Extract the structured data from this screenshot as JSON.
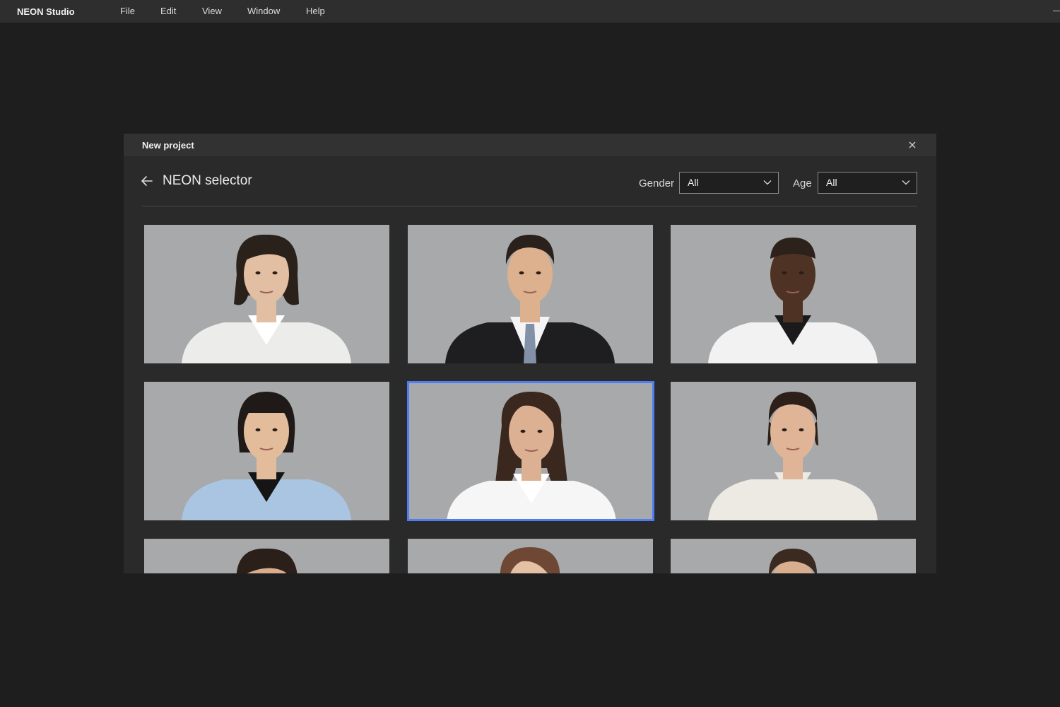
{
  "app": {
    "name": "NEON Studio",
    "menu": [
      "File",
      "Edit",
      "View",
      "Window",
      "Help"
    ]
  },
  "dialog": {
    "title": "New project",
    "heading": "NEON selector",
    "filters": {
      "gender": {
        "label": "Gender",
        "value": "All"
      },
      "age": {
        "label": "Age",
        "value": "All"
      }
    }
  },
  "colors": {
    "accent": "#4f7df2",
    "card_background": "#a7a9aa"
  },
  "avatars": [
    {
      "hair": "#2a211b",
      "skin": "#e2bea2",
      "top": "#ececea",
      "inner": "#ffffff",
      "style": "bob"
    },
    {
      "hair": "#2a211c",
      "skin": "#ddb08e",
      "top": "#1e1e20",
      "inner": "#f4f4f6",
      "style": "suit"
    },
    {
      "hair": "#2c211b",
      "skin": "#4e3324",
      "top": "#f2f2f2",
      "inner": "#1a1a1a",
      "style": "shaved"
    },
    {
      "hair": "#1f1a17",
      "skin": "#e3bc9c",
      "top": "#a9c5e2",
      "inner": "#151515",
      "style": "bangs"
    },
    {
      "hair": "#3a271d",
      "skin": "#dcb092",
      "top": "#f6f6f6",
      "inner": "#ffffff",
      "style": "long",
      "selected": true
    },
    {
      "hair": "#2d2019",
      "skin": "#e0b597",
      "top": "#ede9e3",
      "inner": "#ede9e3",
      "style": "slick"
    },
    {
      "hair": "#2a1f19",
      "skin": "#d9ad8c",
      "top": "#efefef",
      "inner": "#ffffff",
      "style": "bob"
    },
    {
      "hair": "#6e4735",
      "skin": "#e5c0a4",
      "top": "#efefef",
      "inner": "#ffffff",
      "style": "long"
    },
    {
      "hair": "#3a2a20",
      "skin": "#d9ae8e",
      "top": "#efefef",
      "inner": "#ffffff",
      "style": "slick"
    }
  ]
}
